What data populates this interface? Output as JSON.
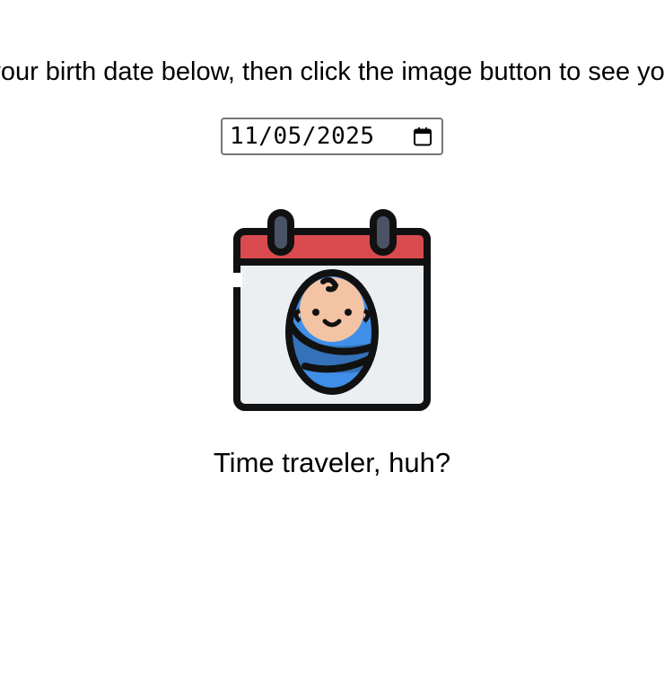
{
  "instructions": "Enter your birth date below, then click the image button to see your age.",
  "date_input": {
    "value": "11/05/2025",
    "picker_icon": "calendar-icon"
  },
  "image_button": {
    "icon": "baby-calendar-icon",
    "colors": {
      "header_red": "#d94a4e",
      "page_gray": "#eceff2",
      "outline": "#111111",
      "ring_gray": "#4a5366",
      "blanket_blue": "#3f8fe8",
      "blanket_dark_blue": "#3571b8",
      "skin": "#f3c3a4"
    }
  },
  "result_text": "Time traveler, huh?"
}
